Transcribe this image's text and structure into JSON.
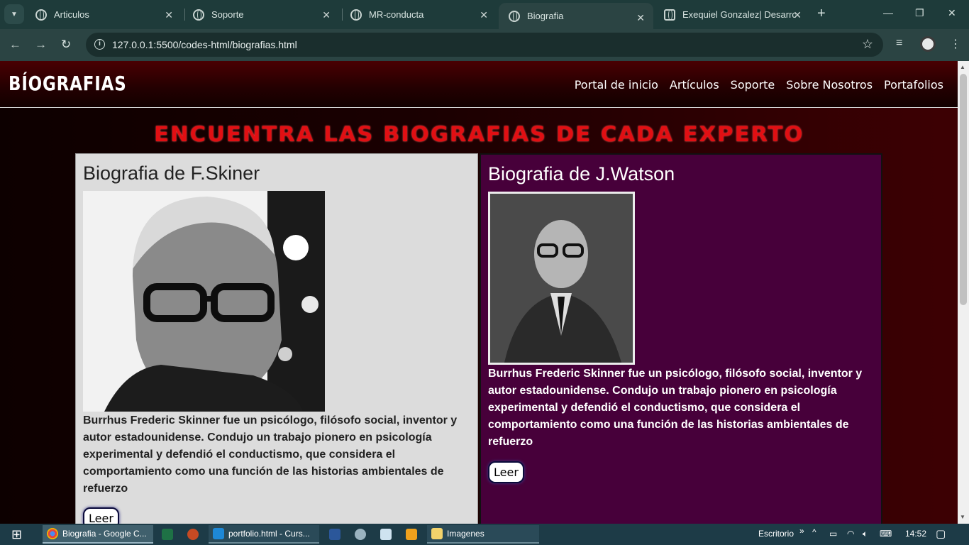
{
  "browser": {
    "tabs": [
      {
        "title": "Articulos"
      },
      {
        "title": "Soporte"
      },
      {
        "title": "MR-conducta"
      },
      {
        "title": "Biografia"
      },
      {
        "title": "Exequiel Gonzalez| Desarrollo"
      }
    ],
    "url": "127.0.0.1:5500/codes-html/biografias.html"
  },
  "site": {
    "brand": "BÍOGRAFIAS",
    "nav": [
      "Portal de inicio",
      "Artículos",
      "Soporte",
      "Sobre Nosotros",
      "Portafolios"
    ],
    "headline": "ENCUENTRA LAS BIOGRAFIAS DE CADA EXPERTO",
    "cards": [
      {
        "title": "Biografia de F.Skiner",
        "text": "Burrhus Frederic Skinner fue un psicólogo, filósofo social, inventor y autor estadounidense. Condujo un trabajo pionero en psicología experimental y defendió el conductismo, que considera el comportamiento como una función de las historias ambientales de refuerzo",
        "button": "Leer"
      },
      {
        "title": "Biografia de J.Watson",
        "text": "Burrhus Frederic Skinner fue un psicólogo, filósofo social, inventor y autor estadounidense. Condujo un trabajo pionero en psicología experimental y defendió el conductismo, que considera el comportamiento como una función de las historias ambientales de refuerzo",
        "button": "Leer"
      }
    ]
  },
  "taskbar": {
    "items": [
      {
        "label": "Biografia - Google C..."
      },
      {
        "label": "portfolio.html - Curs..."
      },
      {
        "label": "Imagenes"
      }
    ],
    "desktop_label": "Escritorio",
    "time": "14:52"
  },
  "colors": {
    "headline": "#e10f13",
    "card_left_bg": "#dcdcdc",
    "card_right_bg": "#47003a",
    "tab_active": "#2b4443"
  }
}
